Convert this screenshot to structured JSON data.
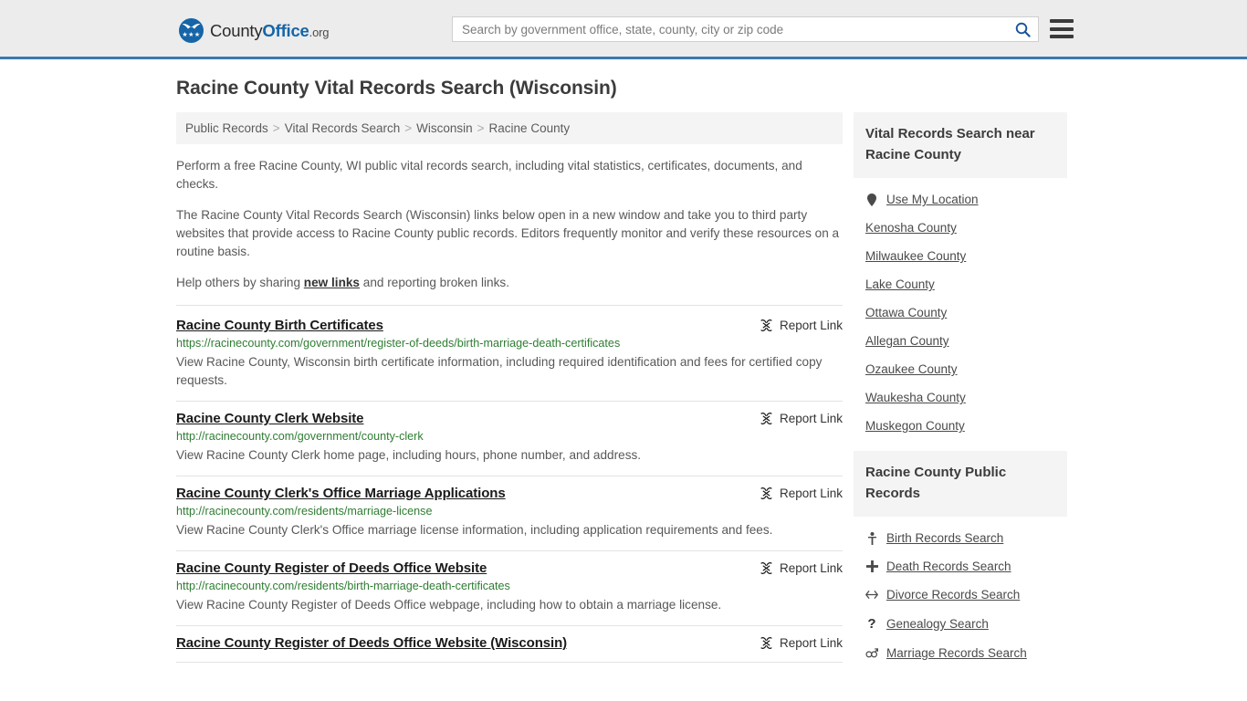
{
  "header": {
    "brand": {
      "part1": "County",
      "part2": "Office",
      "tld": ".org"
    },
    "search": {
      "placeholder": "Search by government office, state, county, city or zip code",
      "value": "",
      "icon": "search-icon"
    },
    "menu_icon": "hamburger-menu-icon",
    "accent_color": "#3a7ab0",
    "background_color": "#ececec"
  },
  "page": {
    "title": "Racine County Vital Records Search (Wisconsin)"
  },
  "breadcrumb": {
    "items": [
      {
        "label": "Public Records"
      },
      {
        "label": "Vital Records Search"
      },
      {
        "label": "Wisconsin"
      },
      {
        "label": "Racine County"
      }
    ],
    "separator": ">"
  },
  "intro": {
    "paragraph1": "Perform a free Racine County, WI public vital records search, including vital statistics, certificates, documents, and checks.",
    "paragraph2": "The Racine County Vital Records Search (Wisconsin) links below open in a new window and take you to third party websites that provide access to Racine County public records. Editors frequently monitor and verify these resources on a routine basis.",
    "paragraph3_pre": "Help others by sharing ",
    "paragraph3_link": "new links",
    "paragraph3_post": " and reporting broken links."
  },
  "results": {
    "report_label": "Report Link",
    "report_icon": "broken-link-icon",
    "url_color": "#2e7d32",
    "items": [
      {
        "title": "Racine County Birth Certificates",
        "url": "https://racinecounty.com/government/register-of-deeds/birth-marriage-death-certificates",
        "description": "View Racine County, Wisconsin birth certificate information, including required identification and fees for certified copy requests."
      },
      {
        "title": "Racine County Clerk Website",
        "url": "http://racinecounty.com/government/county-clerk",
        "description": "View Racine County Clerk home page, including hours, phone number, and address."
      },
      {
        "title": "Racine County Clerk's Office Marriage Applications",
        "url": "http://racinecounty.com/residents/marriage-license",
        "description": "View Racine County Clerk's Office marriage license information, including application requirements and fees."
      },
      {
        "title": "Racine County Register of Deeds Office Website",
        "url": "http://racinecounty.com/residents/birth-marriage-death-certificates",
        "description": "View Racine County Register of Deeds Office webpage, including how to obtain a marriage license."
      },
      {
        "title": "Racine County Register of Deeds Office Website (Wisconsin)",
        "url": "",
        "description": ""
      }
    ]
  },
  "sidebar": {
    "nearby": {
      "heading": "Vital Records Search near Racine County",
      "items": [
        {
          "label": "Use My Location",
          "icon": "map-pin-icon"
        },
        {
          "label": "Kenosha County",
          "icon": ""
        },
        {
          "label": "Milwaukee County",
          "icon": ""
        },
        {
          "label": "Lake County",
          "icon": ""
        },
        {
          "label": "Ottawa County",
          "icon": ""
        },
        {
          "label": "Allegan County",
          "icon": ""
        },
        {
          "label": "Ozaukee County",
          "icon": ""
        },
        {
          "label": "Waukesha County",
          "icon": ""
        },
        {
          "label": "Muskegon County",
          "icon": ""
        }
      ]
    },
    "public_records": {
      "heading": "Racine County Public Records",
      "items": [
        {
          "label": "Birth Records Search",
          "icon": "baby-icon"
        },
        {
          "label": "Death Records Search",
          "icon": "cross-icon"
        },
        {
          "label": "Divorce Records Search",
          "icon": "left-right-arrow-icon"
        },
        {
          "label": "Genealogy Search",
          "icon": "question-mark-icon"
        },
        {
          "label": "Marriage Records Search",
          "icon": "male-female-icon"
        }
      ]
    }
  }
}
